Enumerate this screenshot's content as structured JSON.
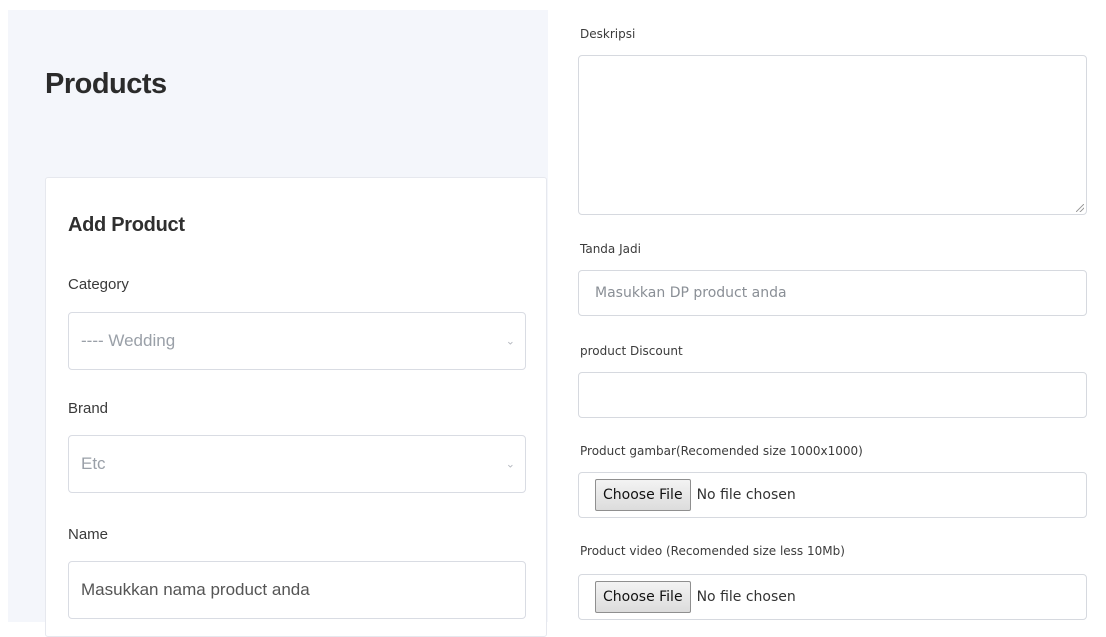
{
  "page": {
    "title": "Products"
  },
  "card": {
    "title": "Add Product",
    "category": {
      "label": "Category",
      "value": "---- Wedding"
    },
    "brand": {
      "label": "Brand",
      "value": "Etc"
    },
    "name": {
      "label": "Name",
      "placeholder": "Masukkan nama product anda"
    }
  },
  "right": {
    "deskripsi": {
      "label": "Deskripsi",
      "value": ""
    },
    "tanda_jadi": {
      "label": "Tanda Jadi",
      "placeholder": "Masukkan DP product anda"
    },
    "discount": {
      "label": "product Discount",
      "value": ""
    },
    "gambar": {
      "label": "Product gambar(Recomended size 1000x1000)",
      "button": "Choose File",
      "status": "No file chosen"
    },
    "video": {
      "label": "Product video (Recomended size less 10Mb)",
      "button": "Choose File",
      "status": "No file chosen"
    }
  }
}
